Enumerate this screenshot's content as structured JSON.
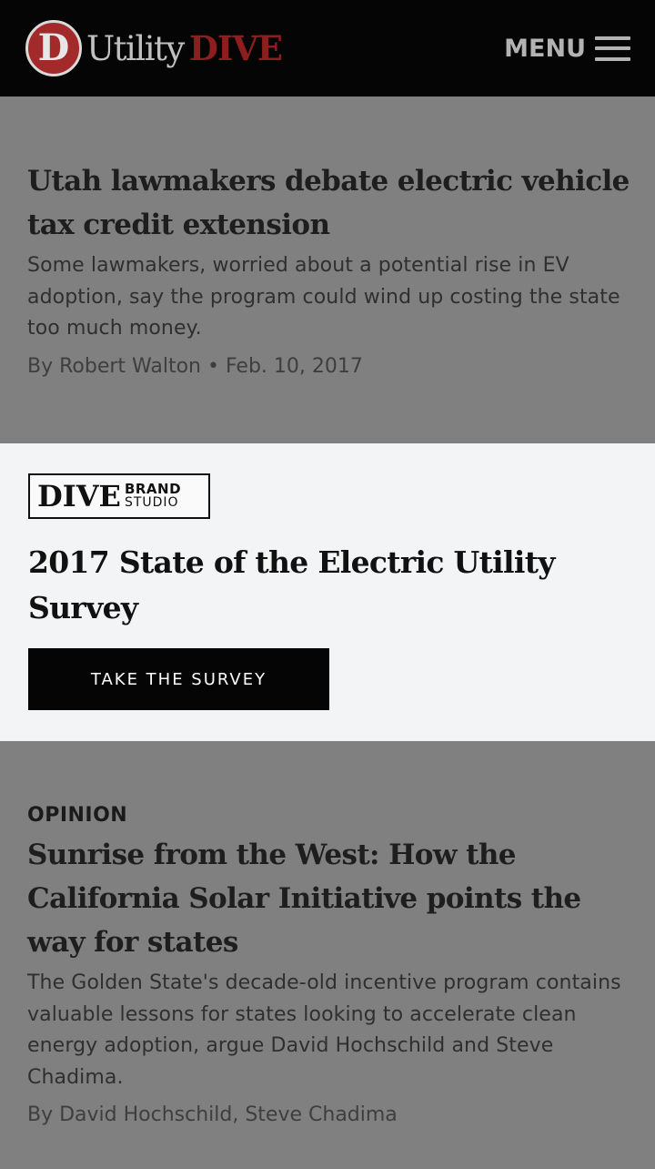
{
  "header": {
    "logo_letter": "D",
    "logo_word1": "Utility",
    "logo_word2": "DIVE",
    "menu_label": "MENU"
  },
  "stories": [
    {
      "headline": "Utah lawmakers debate electric vehicle tax credit extension",
      "dek": "Some lawmakers, worried about a potential rise in EV adoption, say the program could wind up costing the state too much money.",
      "byline": "By Robert Walton • Feb. 10, 2017"
    },
    {
      "label": "OPINION",
      "headline": "Sunrise from the West: How the California Solar Initiative points the way for states",
      "dek": "The Golden State's decade-old incentive program contains valuable lessons for states looking to accelerate clean energy adoption, argue David Hochschild and Steve Chadima.",
      "byline": "By David Hochschild, Steve Chadima"
    }
  ],
  "promo": {
    "brand_main": "DIVE",
    "brand_line1": "BRAND",
    "brand_line2": "STUDIO",
    "title": "2017 State of the Electric Utility Survey",
    "cta_label": "TAKE THE SURVEY"
  },
  "colors": {
    "overlay": "#808080",
    "header_bg": "#050505",
    "brand_red": "#a32a2a",
    "promo_bg": "#f2f4f6"
  }
}
